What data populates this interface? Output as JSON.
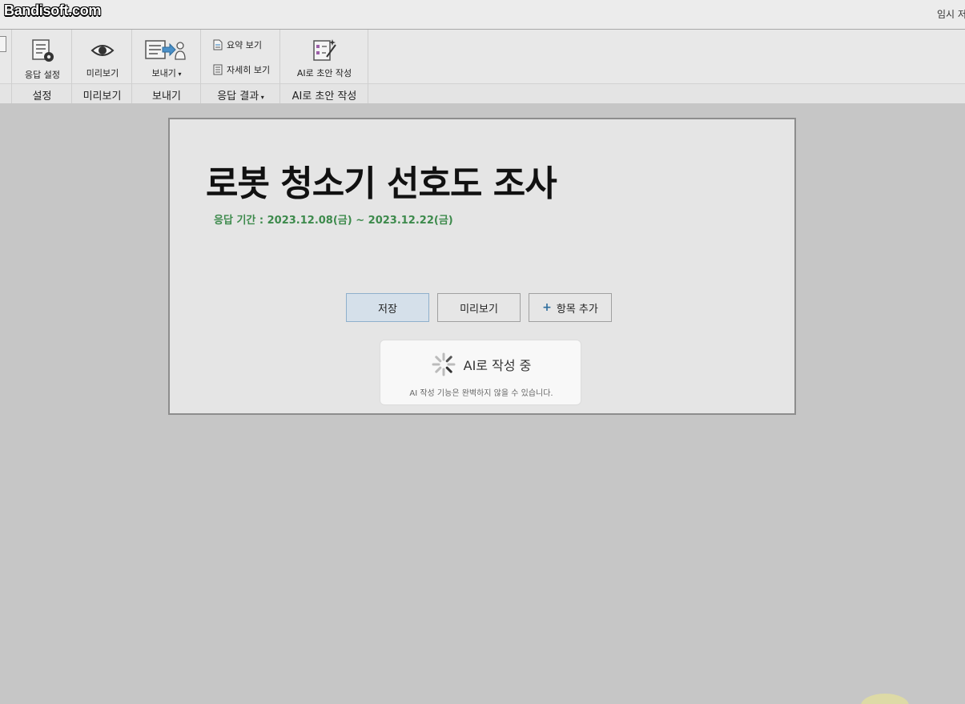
{
  "watermark": "Bandisoft.com",
  "titlebar": {
    "right_text": "임시 저"
  },
  "ribbon": {
    "groups": [
      {
        "label": "설정",
        "buttons": [
          "응답 설정"
        ]
      },
      {
        "label": "미리보기",
        "buttons": [
          "미리보기"
        ]
      },
      {
        "label": "보내기",
        "buttons": [
          "보내기"
        ]
      },
      {
        "label": "응답 결과",
        "buttons": [
          "요약 보기",
          "자세히 보기"
        ]
      },
      {
        "label": "AI로 초안 작성",
        "buttons": [
          "AI로 초안 작성"
        ]
      }
    ]
  },
  "survey": {
    "title": "로봇 청소기 선호도 조사",
    "period": "응답 기간 : 2023.12.08(금) ~ 2023.12.22(금)"
  },
  "actions": {
    "save": "저장",
    "preview": "미리보기",
    "add_item": "항목 추가"
  },
  "ai_panel": {
    "status": "AI로 작성 중",
    "note": "AI 작성 기능은 완벽하지 않을 수 있습니다."
  },
  "colors": {
    "period_text": "#3d8a4c",
    "save_button_bg": "#d5e0ea",
    "canvas_bg": "#c6c6c6"
  }
}
